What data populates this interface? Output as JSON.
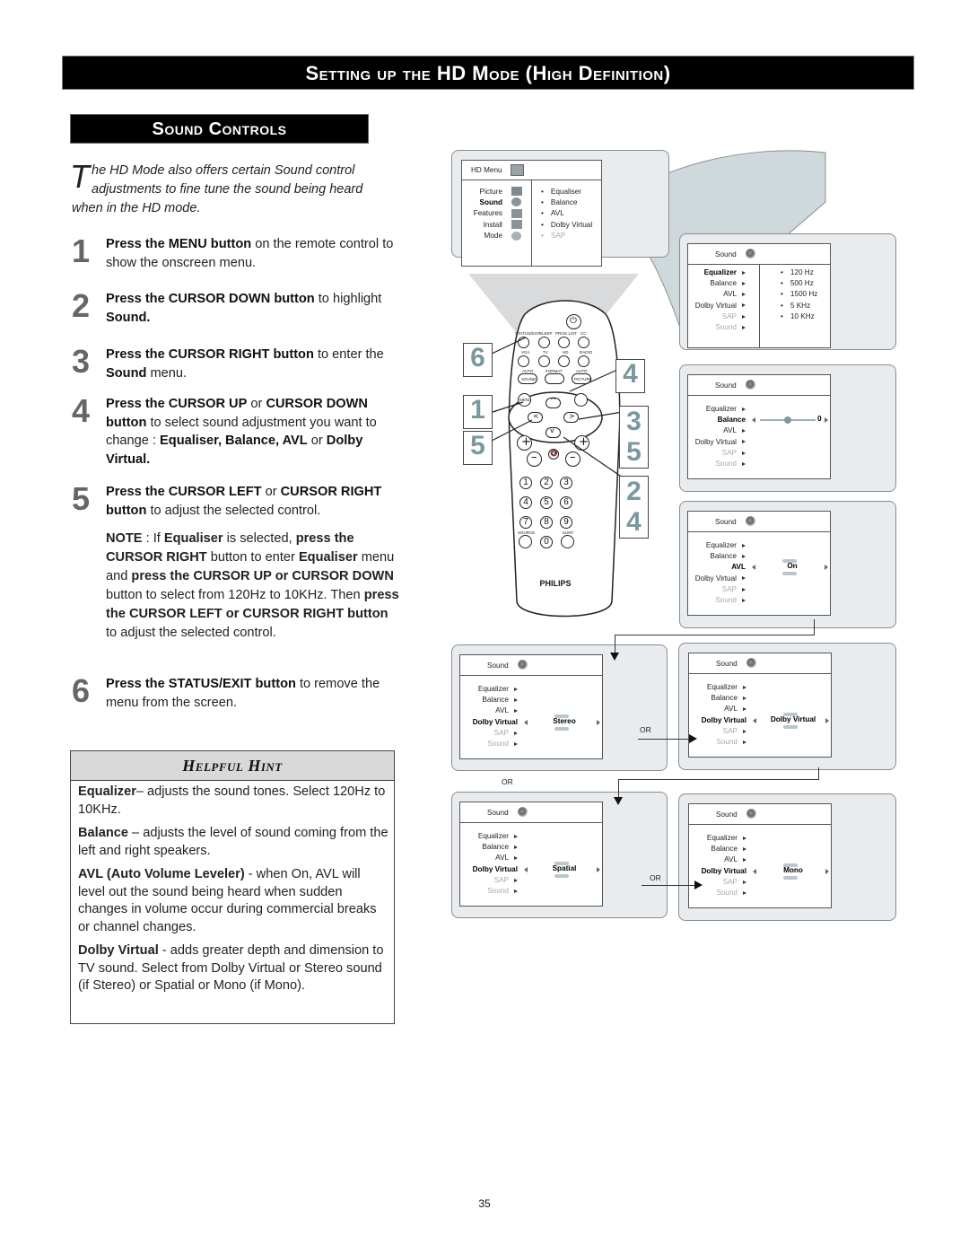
{
  "header": {
    "title": "Setting up the HD Mode (High Definition)",
    "section": "Sound Controls"
  },
  "intro": {
    "dropcap": "T",
    "text": "he HD Mode also offers certain Sound control adjustments to fine tune the sound being heard when in the HD mode."
  },
  "steps": [
    {
      "num": "1",
      "parts": [
        [
          "b",
          "Press the MENU button"
        ],
        [
          "t",
          " on the remote control to show the onscreen menu."
        ]
      ]
    },
    {
      "num": "2",
      "parts": [
        [
          "b",
          "Press the CURSOR DOWN button"
        ],
        [
          "t",
          " to highlight "
        ],
        [
          "b",
          "Sound."
        ]
      ]
    },
    {
      "num": "3",
      "parts": [
        [
          "b",
          "Press the CURSOR RIGHT button"
        ],
        [
          "t",
          " to enter the "
        ],
        [
          "b",
          "Sound"
        ],
        [
          "t",
          " menu."
        ]
      ]
    },
    {
      "num": "4",
      "parts": [
        [
          "b",
          "Press the CURSOR UP"
        ],
        [
          "t",
          " or "
        ],
        [
          "b",
          "CURSOR DOWN button"
        ],
        [
          "t",
          " to select sound adjustment you want to change : "
        ],
        [
          "b",
          "Equaliser, Balance, AVL"
        ],
        [
          "t",
          " or "
        ],
        [
          "b",
          "Dolby Virtual."
        ]
      ]
    },
    {
      "num": "5",
      "parts": [
        [
          "b",
          "Press the CURSOR LEFT"
        ],
        [
          "t",
          " or "
        ],
        [
          "b",
          "CURSOR RIGHT button"
        ],
        [
          "t",
          " to adjust the selected control."
        ]
      ]
    },
    {
      "num": "6",
      "parts": [
        [
          "b",
          "Press the STATUS/EXIT button"
        ],
        [
          "t",
          " to remove the menu from the screen."
        ]
      ]
    }
  ],
  "note": {
    "parts": [
      [
        "b",
        "NOTE"
      ],
      [
        "t",
        " : If "
      ],
      [
        "b",
        "Equaliser"
      ],
      [
        "t",
        " is selected, "
      ],
      [
        "b",
        "press the CURSOR RIGHT"
      ],
      [
        "t",
        " button to enter "
      ],
      [
        "b",
        "Equaliser"
      ],
      [
        "t",
        " menu and "
      ],
      [
        "b",
        "press the CURSOR UP or CURSOR DOWN"
      ],
      [
        "t",
        "  button to select from 120Hz to 10KHz. Then "
      ],
      [
        "b",
        "press the CURSOR LEFT or CURSOR RIGHT button"
      ],
      [
        "t",
        " to adjust the selected control."
      ]
    ]
  },
  "hint": {
    "title": "Helpful Hint",
    "items": [
      {
        "term": "Equalizer",
        "text": "– adjusts the sound tones. Select 120Hz  to 10KHz."
      },
      {
        "term": "Balance",
        "text": " – adjusts the level of sound coming from the left and right speakers."
      },
      {
        "term": "AVL (Auto Volume Leveler)",
        "text": " - when On, AVL will level out the sound being heard when sudden changes in volume occur during commercial breaks or channel changes."
      },
      {
        "term": "Dolby Virtual",
        "text": " - adds greater depth and dimension to TV sound. Select from Dolby Virtual or Stereo sound (if Stereo) or Spatial or Mono (if Mono)."
      }
    ]
  },
  "hd_menu": {
    "title": "HD Menu",
    "items": [
      "Picture",
      "Sound",
      "Features",
      "Install",
      "Mode"
    ],
    "selected": "Sound",
    "submenu": [
      "Equaliser",
      "Balance",
      "AVL",
      "Dolby Virtual",
      "SAP"
    ],
    "submenu_disabled": [
      "SAP"
    ]
  },
  "sound_menu": {
    "title": "Sound",
    "items": [
      "Equalizer",
      "Balance",
      "AVL",
      "Dolby Virtual",
      "SAP",
      "Sound"
    ],
    "disabled": [
      "SAP",
      "Sound"
    ]
  },
  "equalizer_bands": [
    "120 Hz",
    "500 Hz",
    "1500 Hz",
    "5 KHz",
    "10 KHz"
  ],
  "screens": {
    "balance": {
      "selected": "Balance",
      "value": "0",
      "slider_position": 0.5
    },
    "avl": {
      "selected": "AVL",
      "value": "On"
    },
    "dolby_stereo": {
      "selected": "Dolby Virtual",
      "value": "Stereo"
    },
    "dolby_virtual": {
      "selected": "Dolby Virtual",
      "value": "Dolby Virtual"
    },
    "dolby_spatial": {
      "selected": "Dolby Virtual",
      "value": "Spatial"
    },
    "dolby_mono": {
      "selected": "Dolby Virtual",
      "value": "Mono"
    }
  },
  "or_label": "OR",
  "remote": {
    "brand": "PHILIPS",
    "top_row": [
      "STATUS/EXIT",
      "SLEEP",
      "PROG.LIST",
      "CC"
    ],
    "second_row": [
      "VGA",
      "TV",
      "HD",
      "RADIO"
    ],
    "third_row_labels": [
      "AUTO",
      "FORMAT",
      "AUTO"
    ],
    "third_row_buttons": [
      "SOUND",
      "",
      "PICTURE"
    ],
    "menu_label": "MENU",
    "digits": [
      "1",
      "2",
      "3",
      "4",
      "5",
      "6",
      "7",
      "8",
      "9",
      "0"
    ],
    "source_label": "SOURCE",
    "surf_label": "SURF",
    "callouts": {
      "left_top": "6",
      "left_mid": "1",
      "left_bot": "5",
      "right_top": "4",
      "right_mid1": "3",
      "right_mid2": "5",
      "right_low": "2",
      "right_low2": "4"
    }
  },
  "page_number": "35"
}
